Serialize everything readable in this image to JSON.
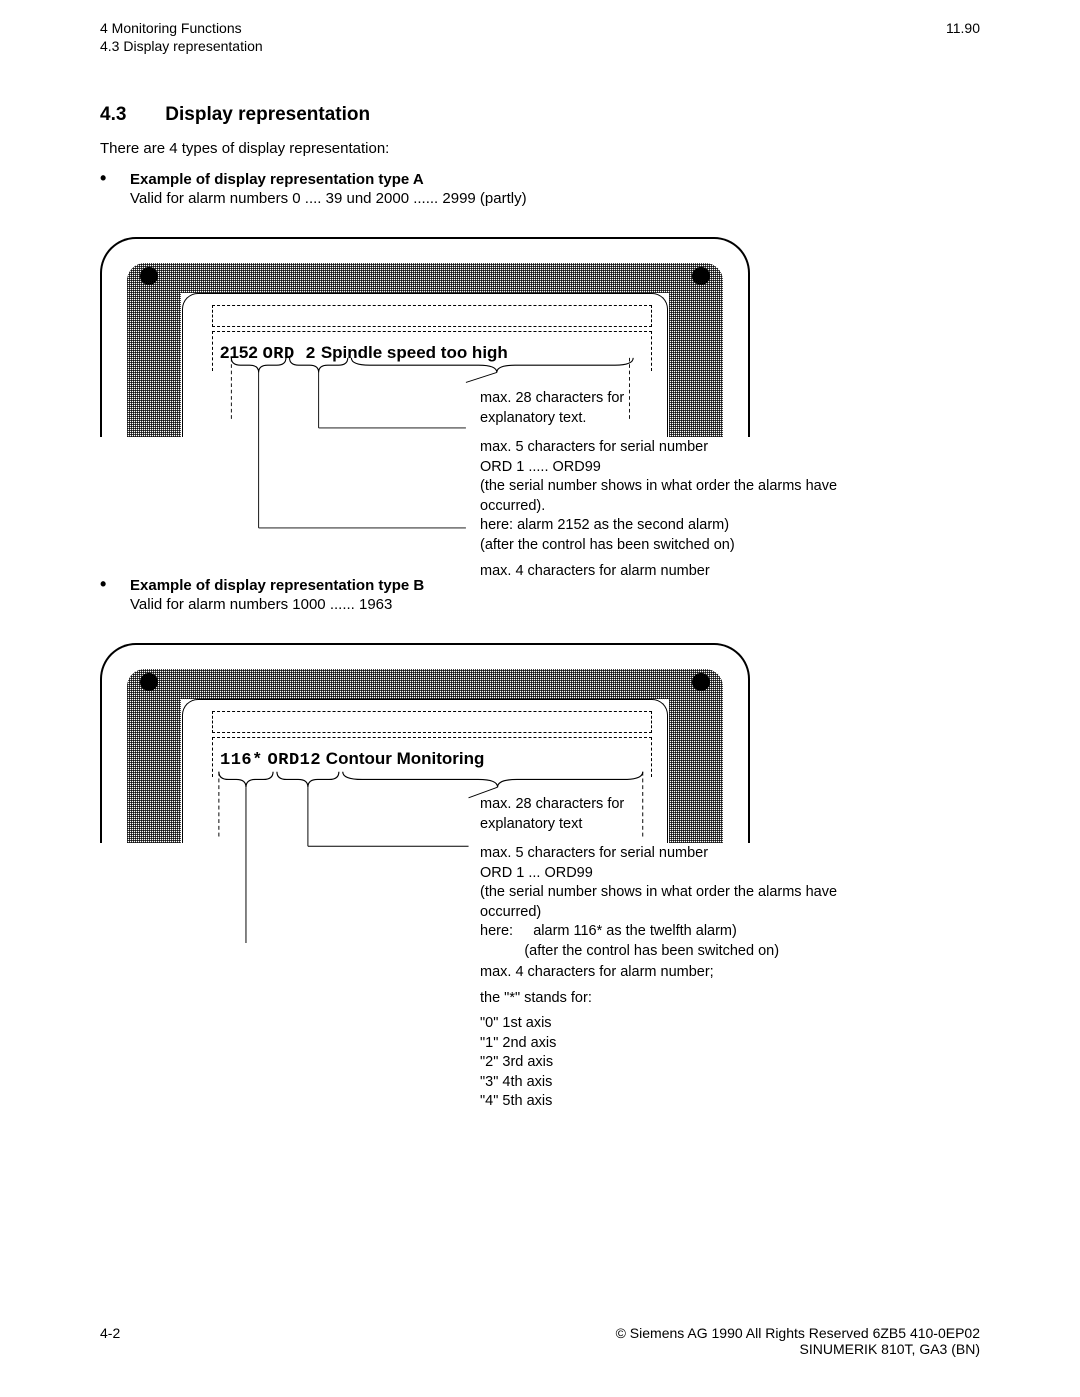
{
  "header": {
    "chapter": "4  Monitoring Functions",
    "subsection_ref": "4.3  Display representation",
    "date": "11.90"
  },
  "section": {
    "number": "4.3",
    "title": "Display representation",
    "intro": "There are 4 types of display representation:"
  },
  "exampleA": {
    "bullet_title": "Example of display representation type   A",
    "bullet_sub": "Valid for alarm numbers 0 .... 39 und 2000 ...... 2999 (partly)",
    "alarm_num": "2152",
    "alarm_ord": "ORD 2",
    "alarm_text": "Spindle  speed  too  high",
    "callout1a": "max. 28 characters for",
    "callout1b": "explanatory text.",
    "callout2a": "max. 5 characters for serial number",
    "callout2b": "ORD 1 ..... ORD99",
    "callout2c": "(the serial number shows in what order the alarms have occurred).",
    "callout2d": "here: alarm 2152 as the second alarm)",
    "callout2e": "(after the control has been switched on)",
    "callout3": "max. 4 characters for alarm number"
  },
  "exampleB": {
    "bullet_title": "Example of display representation type    B",
    "bullet_sub": "Valid for alarm numbers 1000 ...... 1963",
    "alarm_num": "116*",
    "alarm_ord": "ORD12",
    "alarm_text": "Contour Monitoring",
    "callout1a": "max. 28 characters for",
    "callout1b": "explanatory text",
    "callout2a": "max. 5 characters for serial number",
    "callout2b": "ORD 1 ... ORD99",
    "callout2c": "(the serial number shows in what order the alarms have occurred)",
    "callout2d_label": "here:",
    "callout2d": "alarm 116* as the twelfth alarm)",
    "callout2e": "(after the control has been switched on)",
    "callout3a": "max. 4 characters for alarm number;",
    "callout3b": "the \"*\" stands for:",
    "axis0": "\"0\"  1st axis",
    "axis1": "\"1\"  2nd axis",
    "axis2": "\"2\"  3rd axis",
    "axis3": "\"3\"  4th axis",
    "axis4": "\"4\"  5th axis"
  },
  "footer": {
    "page": "4-2",
    "copyright": "© Siemens AG 1990 All Rights Reserved    6ZB5 410-0EP02",
    "product": "SINUMERIK 810T, GA3 (BN)"
  }
}
